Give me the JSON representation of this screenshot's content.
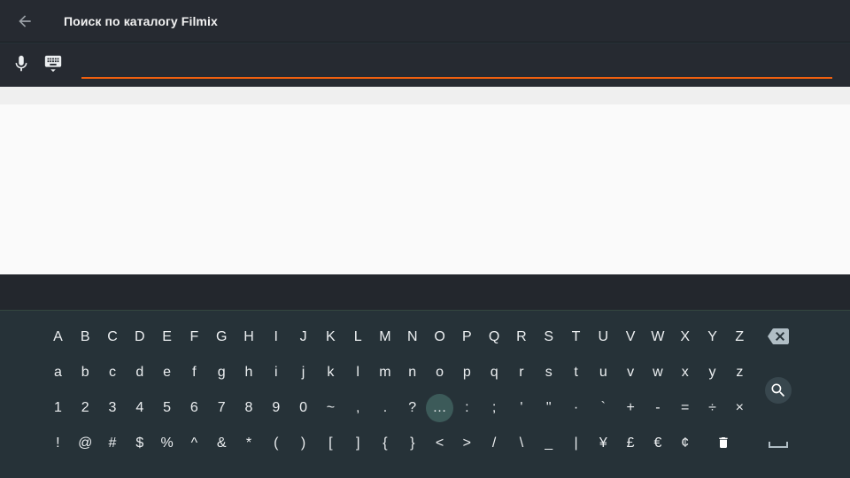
{
  "header": {
    "title": "Поиск по каталогу Filmix"
  },
  "search": {
    "value": "",
    "placeholder": ""
  },
  "icons": {
    "back": "arrow-left-icon",
    "mic": "microphone-icon",
    "keyboard": "keyboard-icon",
    "backspace": "backspace-icon",
    "search": "search-icon",
    "delete": "trash-icon",
    "space": "space-icon"
  },
  "colors": {
    "accent": "#f0600f",
    "keyboard_bg": "#263238",
    "header_bg": "#262a31",
    "focus": "#3c5a59"
  },
  "keyboard": {
    "row1": [
      "A",
      "B",
      "C",
      "D",
      "E",
      "F",
      "G",
      "H",
      "I",
      "J",
      "K",
      "L",
      "M",
      "N",
      "O",
      "P",
      "Q",
      "R",
      "S",
      "T",
      "U",
      "V",
      "W",
      "X",
      "Y",
      "Z"
    ],
    "row2": [
      "a",
      "b",
      "c",
      "d",
      "e",
      "f",
      "g",
      "h",
      "i",
      "j",
      "k",
      "l",
      "m",
      "n",
      "o",
      "p",
      "q",
      "r",
      "s",
      "t",
      "u",
      "v",
      "w",
      "x",
      "y",
      "z"
    ],
    "row3": [
      "1",
      "2",
      "3",
      "4",
      "5",
      "6",
      "7",
      "8",
      "9",
      "0",
      "~",
      ",",
      ".",
      "?",
      "…",
      ":",
      ";",
      "'",
      "\"",
      "·",
      "`",
      "+",
      "-",
      "=",
      "÷",
      "×"
    ],
    "row4": [
      "!",
      "@",
      "#",
      "$",
      "%",
      "^",
      "&",
      "*",
      "(",
      ")",
      "[",
      "]",
      "{",
      "}",
      "<",
      ">",
      "/",
      "\\",
      "_",
      "|",
      "¥",
      "£",
      "€",
      "¢"
    ]
  }
}
